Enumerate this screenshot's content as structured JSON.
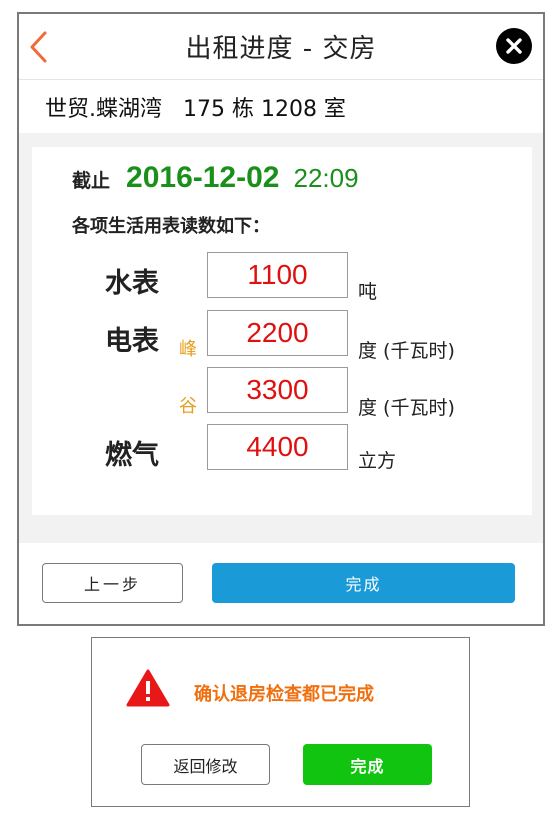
{
  "header": {
    "title": "出租进度 - 交房",
    "back_icon": "chevron-left-icon",
    "close_icon": "close-icon",
    "back_color": "#f06a3a"
  },
  "address": "世贸.蝶湖湾   175 栋 1208 室",
  "reading": {
    "cutoff_label": "截止",
    "date": "2016-12-02",
    "time": "22:09",
    "date_color": "#1a8f1a",
    "instruction": "各项生活用表读数如下："
  },
  "meters": {
    "water": {
      "label": "水表",
      "value": "1100",
      "unit": "吨"
    },
    "electric": {
      "label": "电表",
      "peak": {
        "label": "峰",
        "value": "2200",
        "unit": "度 (千瓦时)"
      },
      "valley": {
        "label": "谷",
        "value": "3300",
        "unit": "度 (千瓦时)"
      }
    },
    "gas": {
      "label": "燃气",
      "value": "4400",
      "unit": "立方"
    }
  },
  "actions": {
    "prev_label": "上一步",
    "done_label": "完成",
    "done_color": "#1a9ad6"
  },
  "dialog": {
    "icon": "warning-icon",
    "message": "确认退房检查都已完成",
    "modify_label": "返回修改",
    "confirm_label": "完成",
    "message_color": "#f07010",
    "confirm_color": "#10c410",
    "icon_color": "#e81818"
  }
}
